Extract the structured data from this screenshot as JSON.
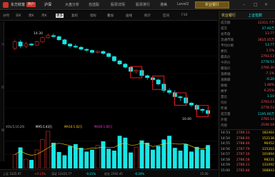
{
  "app": {
    "brand": "东方财富",
    "badge": "开户",
    "title_tab": "农业银行"
  },
  "menu": [
    "沪深",
    "大盘分析",
    "自选股",
    "股票详情",
    "股票排行",
    "港美",
    "Level2"
  ],
  "toolbar": {
    "items": [
      "分时",
      "日K",
      "周K",
      "月K",
      "更多",
      "复权",
      "指标",
      "叠加",
      "画线",
      "统计",
      "区间",
      "F10"
    ],
    "selected_index": 4
  },
  "left_strip": [
    "分",
    "析",
    "图"
  ],
  "legend": {
    "vol": "VOL(5,10,20)",
    "ma5": "MA5:1.43万",
    "ma10": "MA10:1.62万",
    "ma20": "MA20:1.85万"
  },
  "bottom_status": [
    "上证 3325.97",
    "+0.12%",
    "深证 12435.77",
    "-0.21%",
    "创业 2592.45",
    "-0.34%",
    "15:00"
  ],
  "right_panel": {
    "header_title": "农业银行",
    "header_code": "上证指数",
    "stats": [
      {
        "k": "成交额",
        "v": "12311.7万"
      },
      {
        "k": "成交",
        "v": "37.40万"
      },
      {
        "k": "总市值",
        "v": "13.77"
      },
      {
        "k": "流通市值",
        "v": "3815.35万"
      },
      {
        "k": "平均价格",
        "v": "13.77"
      },
      {
        "k": "委比",
        "v": "1.5%"
      },
      {
        "k": "最高价",
        "v": "2793.13"
      },
      {
        "k": "今开价",
        "v": "2778.53"
      },
      {
        "k": "最低价",
        "v": "2766.30"
      },
      {
        "k": "涨跌幅",
        "v": "-7.1%"
      },
      {
        "k": "涨跌额",
        "v": "-0.20"
      },
      {
        "k": "振幅",
        "v": "1.48%"
      },
      {
        "k": "换手",
        "v": "0.25%"
      },
      {
        "k": "量比",
        "v": "1.10"
      },
      {
        "k": "均价",
        "v": "2793.13"
      },
      {
        "k": "昨收",
        "v": "2778.53"
      },
      {
        "k": "成交量",
        "v": "1195.00万"
      },
      {
        "k": "外盘",
        "v": "2781.14"
      },
      {
        "k": "内盘",
        "v": "2194.18"
      }
    ],
    "ticks": [
      {
        "t": "14:53",
        "p": "2789.13",
        "v": "182464"
      },
      {
        "t": "14:54",
        "p": "2788.93",
        "v": "152138"
      },
      {
        "t": "14:55",
        "p": "2788.46",
        "v": "96452"
      },
      {
        "t": "14:56",
        "p": "2787.79",
        "v": "115203"
      },
      {
        "t": "14:57",
        "p": "2787.16",
        "v": "101894"
      },
      {
        "t": "14:58",
        "p": "2786.58",
        "v": "98231"
      },
      {
        "t": "14:59",
        "p": "2786.11",
        "v": "131092"
      },
      {
        "t": "15:00",
        "p": "2785.84",
        "v": "168843"
      }
    ]
  },
  "colors": {
    "up": "#ff3b3b",
    "down": "#19e6e6",
    "ma5": "#ffffff",
    "ma10": "#ffd400",
    "ma20": "#ff3ad8",
    "highlight_box": "#ff2020"
  },
  "chart_data": {
    "type": "candlestick",
    "candles": [
      {
        "o": 13.6,
        "c": 13.9,
        "h": 14.0,
        "l": 13.5
      },
      {
        "o": 13.9,
        "c": 13.7,
        "h": 14.0,
        "l": 13.6
      },
      {
        "o": 13.7,
        "c": 13.8,
        "h": 13.9,
        "l": 13.6
      },
      {
        "o": 13.8,
        "c": 13.75,
        "h": 13.85,
        "l": 13.7
      },
      {
        "o": 13.75,
        "c": 13.9,
        "h": 13.95,
        "l": 13.7
      },
      {
        "o": 13.9,
        "c": 14.1,
        "h": 14.15,
        "l": 13.85
      },
      {
        "o": 14.1,
        "c": 14.2,
        "h": 14.3,
        "l": 14.05
      },
      {
        "o": 14.2,
        "c": 14.15,
        "h": 14.3,
        "l": 14.1
      },
      {
        "o": 14.15,
        "c": 14.0,
        "h": 14.2,
        "l": 13.95
      },
      {
        "o": 14.0,
        "c": 13.8,
        "h": 14.05,
        "l": 13.75
      },
      {
        "o": 13.8,
        "c": 13.7,
        "h": 13.85,
        "l": 13.6
      },
      {
        "o": 13.7,
        "c": 13.65,
        "h": 13.8,
        "l": 13.6
      },
      {
        "o": 13.65,
        "c": 13.55,
        "h": 13.7,
        "l": 13.5
      },
      {
        "o": 13.55,
        "c": 13.5,
        "h": 13.6,
        "l": 13.45
      },
      {
        "o": 13.5,
        "c": 13.4,
        "h": 13.55,
        "l": 13.35
      },
      {
        "o": 13.4,
        "c": 13.45,
        "h": 13.5,
        "l": 13.35
      },
      {
        "o": 13.45,
        "c": 13.35,
        "h": 13.5,
        "l": 13.3
      },
      {
        "o": 13.35,
        "c": 13.2,
        "h": 13.4,
        "l": 13.15
      },
      {
        "o": 13.2,
        "c": 13.0,
        "h": 13.25,
        "l": 12.95
      },
      {
        "o": 13.0,
        "c": 12.85,
        "h": 13.05,
        "l": 12.8
      },
      {
        "o": 12.85,
        "c": 12.7,
        "h": 12.9,
        "l": 12.65
      },
      {
        "o": 12.7,
        "c": 12.5,
        "h": 12.75,
        "l": 12.45
      },
      {
        "o": 12.5,
        "c": 12.55,
        "h": 12.6,
        "l": 12.4
      },
      {
        "o": 12.55,
        "c": 12.3,
        "h": 12.6,
        "l": 12.25
      },
      {
        "o": 12.3,
        "c": 12.2,
        "h": 12.35,
        "l": 12.1
      },
      {
        "o": 12.2,
        "c": 12.1,
        "h": 12.3,
        "l": 12.0
      },
      {
        "o": 12.1,
        "c": 11.9,
        "h": 12.15,
        "l": 11.85
      },
      {
        "o": 11.9,
        "c": 11.6,
        "h": 11.95,
        "l": 11.5
      },
      {
        "o": 11.6,
        "c": 11.5,
        "h": 11.7,
        "l": 11.4
      },
      {
        "o": 11.5,
        "c": 11.3,
        "h": 11.6,
        "l": 11.2
      },
      {
        "o": 11.3,
        "c": 11.25,
        "h": 11.35,
        "l": 11.1
      },
      {
        "o": 11.25,
        "c": 11.0,
        "h": 11.3,
        "l": 10.9
      },
      {
        "o": 11.0,
        "c": 10.9,
        "h": 11.05,
        "l": 10.8
      },
      {
        "o": 10.9,
        "c": 10.7,
        "h": 10.95,
        "l": 10.6
      },
      {
        "o": 10.7,
        "c": 10.65,
        "h": 10.75,
        "l": 10.55
      },
      {
        "o": 10.65,
        "c": 10.5,
        "h": 10.7,
        "l": 10.4
      }
    ],
    "volumes": [
      30,
      45,
      20,
      18,
      40,
      62,
      80,
      55,
      35,
      28,
      48,
      52,
      44,
      36,
      40,
      50,
      58,
      42,
      38,
      70,
      66,
      34,
      46,
      60,
      55,
      40,
      48,
      62,
      70,
      44,
      38,
      52,
      36,
      46,
      40,
      50
    ],
    "ylim": [
      10.2,
      14.6
    ],
    "highlight_candle_indices": [
      22,
      26,
      30,
      34
    ],
    "label_high": "14.30",
    "label_low": "10.40"
  }
}
